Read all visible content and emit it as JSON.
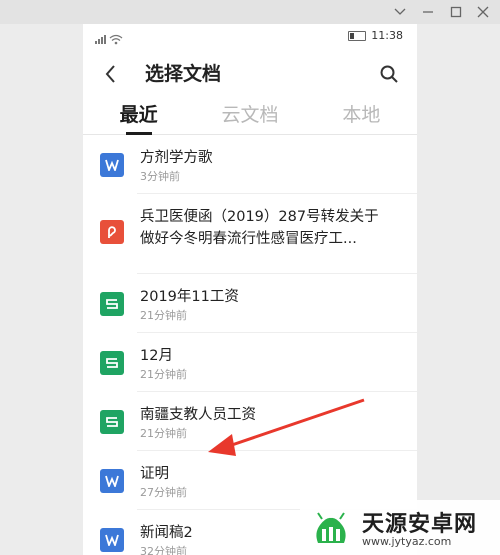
{
  "status": {
    "time": "11:38"
  },
  "header": {
    "title": "选择文档"
  },
  "tabs": [
    {
      "label": "最近"
    },
    {
      "label": "云文档"
    },
    {
      "label": "本地"
    }
  ],
  "files": [
    {
      "name": "方剂学方歌",
      "time": "3分钟前",
      "type": "word-doc",
      "color": "#3c78d8"
    },
    {
      "name": "兵卫医便函（2019）287号转发关于做好今冬明春流行性感冒医疗工...",
      "time": "",
      "type": "pdf",
      "color": "#e8503a"
    },
    {
      "name": "2019年11工资",
      "time": "21分钟前",
      "type": "spreadsheet",
      "color": "#1fa463"
    },
    {
      "name": "12月",
      "time": "21分钟前",
      "type": "spreadsheet",
      "color": "#1fa463"
    },
    {
      "name": "南疆支教人员工资",
      "time": "21分钟前",
      "type": "spreadsheet",
      "color": "#1fa463"
    },
    {
      "name": "证明",
      "time": "27分钟前",
      "type": "word-doc",
      "color": "#3c78d8"
    },
    {
      "name": "新闻稿2",
      "time": "32分钟前",
      "type": "word-doc",
      "color": "#3c78d8"
    }
  ],
  "watermark": {
    "title": "天源安卓网",
    "url": "www.jytyaz.com"
  },
  "colors": {
    "arrow": "#e8382c",
    "word": "#3c78d8",
    "pdf": "#e8503a",
    "sheet": "#1fa463"
  }
}
